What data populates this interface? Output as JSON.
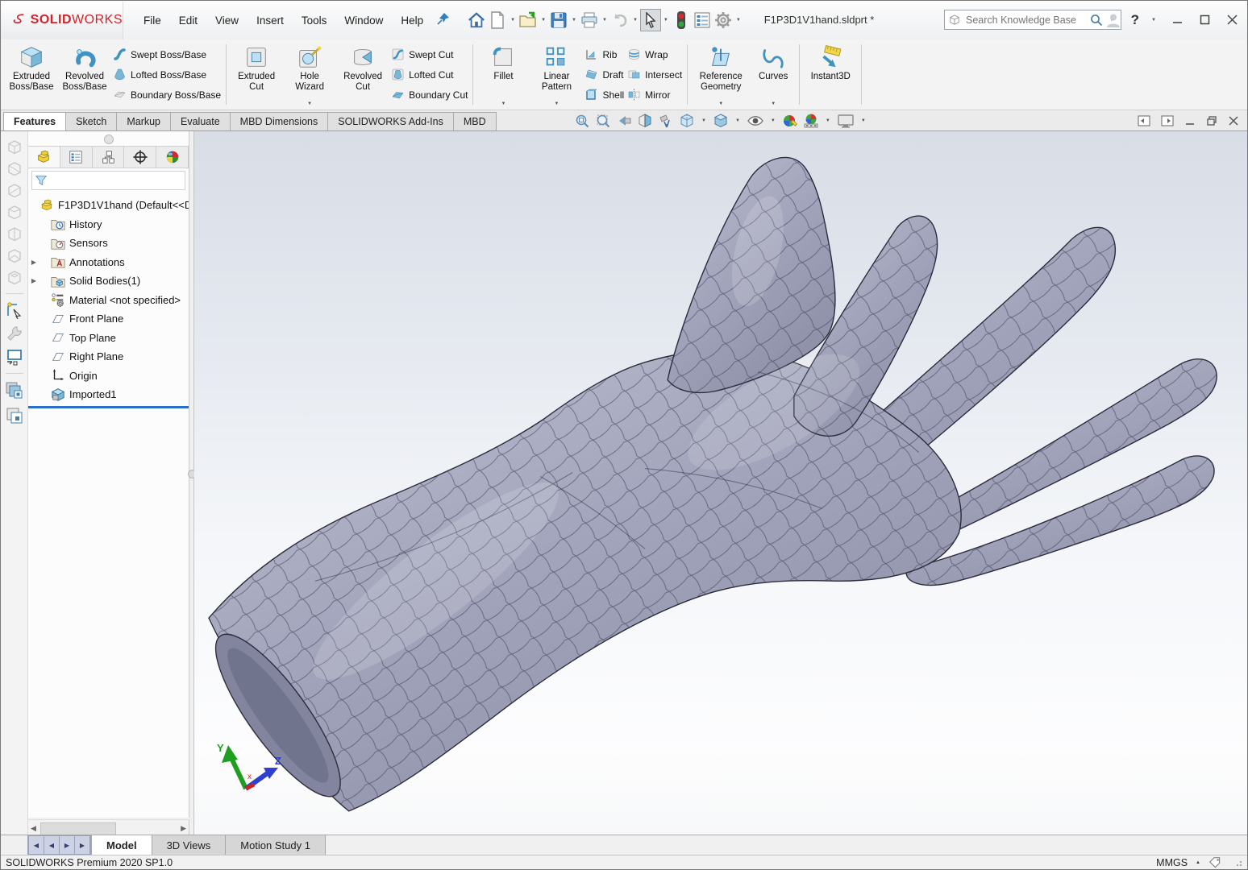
{
  "window": {
    "title": "F1P3D1V1hand.sldprt *"
  },
  "brand": {
    "bold": "SOLID",
    "light": "WORKS"
  },
  "menu": {
    "items": [
      "File",
      "Edit",
      "View",
      "Insert",
      "Tools",
      "Window",
      "Help"
    ]
  },
  "search": {
    "placeholder": "Search Knowledge Base"
  },
  "titlebar": {
    "help": "?"
  },
  "ribbon": {
    "extruded_boss": "Extruded Boss/Base",
    "revolved_boss": "Revolved Boss/Base",
    "swept_boss": "Swept Boss/Base",
    "lofted_boss": "Lofted Boss/Base",
    "boundary_boss": "Boundary Boss/Base",
    "extruded_cut": "Extruded Cut",
    "hole_wizard": "Hole Wizard",
    "revolved_cut": "Revolved Cut",
    "swept_cut": "Swept Cut",
    "lofted_cut": "Lofted Cut",
    "boundary_cut": "Boundary Cut",
    "fillet": "Fillet",
    "linear_pattern": "Linear Pattern",
    "rib": "Rib",
    "draft": "Draft",
    "shell": "Shell",
    "wrap": "Wrap",
    "intersect": "Intersect",
    "mirror": "Mirror",
    "reference_geometry": "Reference Geometry",
    "curves": "Curves",
    "instant3d": "Instant3D"
  },
  "tabs": {
    "items": [
      "Features",
      "Sketch",
      "Markup",
      "Evaluate",
      "MBD Dimensions",
      "SOLIDWORKS Add-Ins",
      "MBD"
    ]
  },
  "tree": {
    "root": "F1P3D1V1hand (Default<<D",
    "items": [
      "History",
      "Sensors",
      "Annotations",
      "Solid Bodies(1)",
      "Material <not specified>",
      "Front Plane",
      "Top Plane",
      "Right Plane",
      "Origin",
      "Imported1"
    ]
  },
  "viewport": {
    "triad": {
      "x": "x",
      "y": "Y",
      "z": "Z"
    }
  },
  "doc_tabs": {
    "items": [
      "Model",
      "3D Views",
      "Motion Study 1"
    ]
  },
  "status": {
    "product": "SOLIDWORKS Premium 2020 SP1.0",
    "units": "MMGS"
  },
  "glyphs": {
    "dropdown": "▼",
    "expander": "▶",
    "up_caret": "▲",
    "scroll_left": "◀",
    "scroll_right": "▶",
    "nav_first": "◀",
    "nav_prev": "◀",
    "nav_next": "▶",
    "nav_last": "▶"
  },
  "colors": {
    "brand_red": "#d2232a",
    "icon_blue": "#3f93c2",
    "rollback_blue": "#2a6fc9",
    "model_fill": "#a3a5bc"
  }
}
